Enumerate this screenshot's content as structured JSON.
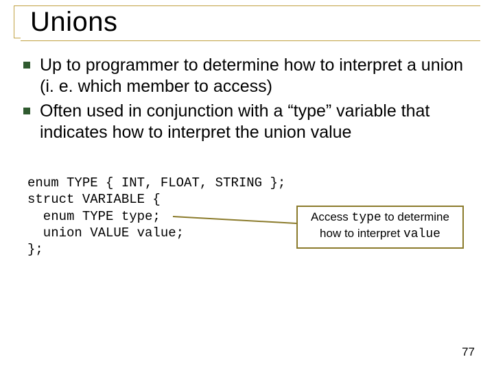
{
  "title": "Unions",
  "bullets": [
    "Up to programmer to determine how to interpret a union (i. e. which member to access)",
    "Often used in conjunction with a “type” variable that indicates how to interpret the union value"
  ],
  "code": {
    "l1": "enum TYPE { INT, FLOAT, STRING };",
    "l2": "struct VARIABLE {",
    "l3": "  enum TYPE type;",
    "l4": "  union VALUE value;",
    "l5": "};"
  },
  "callout": {
    "part1": "Access ",
    "mono1": "type",
    "part2": " to determine how to interpret ",
    "mono2": "value"
  },
  "page_number": "77"
}
